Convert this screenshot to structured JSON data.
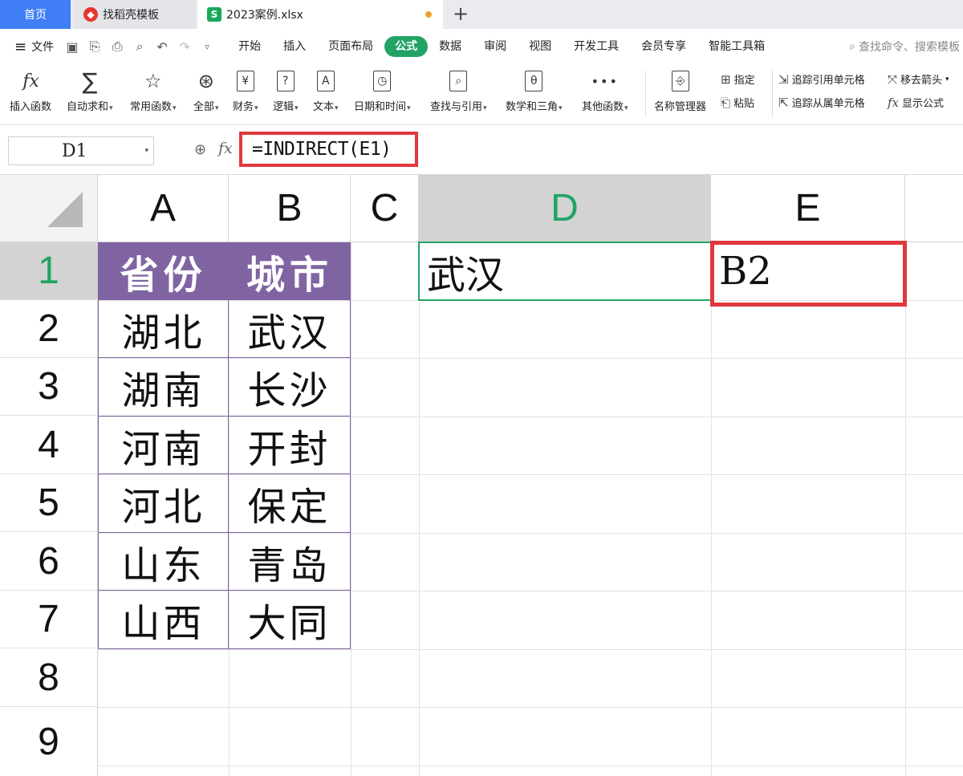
{
  "tabs": {
    "home": "首页",
    "template": "找稻壳模板",
    "file": "2023案例.xlsx"
  },
  "menu": {
    "file_label": "文件",
    "items": [
      "开始",
      "插入",
      "页面布局",
      "公式",
      "数据",
      "审阅",
      "视图",
      "开发工具",
      "会员专享",
      "智能工具箱"
    ],
    "active": "公式",
    "search_placeholder": "查找命令、搜索模板"
  },
  "ribbon": {
    "insert_function": "插入函数",
    "autosum": "自动求和",
    "common": "常用函数",
    "all": "全部",
    "finance": "财务",
    "logic": "逻辑",
    "text": "文本",
    "datetime": "日期和时间",
    "lookup": "查找与引用",
    "math": "数学和三角",
    "other": "其他函数",
    "name_manager": "名称管理器",
    "assign": "指定",
    "paste": "粘贴",
    "trace_precedents": "追踪引用单元格",
    "trace_dependents": "追踪从属单元格",
    "remove_arrows": "移去箭头",
    "show_formulas": "显示公式"
  },
  "formula_bar": {
    "name_box": "D1",
    "formula": "=INDIRECT(E1)"
  },
  "columns": [
    "A",
    "B",
    "C",
    "D",
    "E"
  ],
  "rows": [
    "1",
    "2",
    "3",
    "4",
    "5",
    "6",
    "7",
    "8",
    "9"
  ],
  "table": {
    "headers": [
      "省份",
      "城市"
    ],
    "rows": [
      [
        "湖北",
        "武汉"
      ],
      [
        "湖南",
        "长沙"
      ],
      [
        "河南",
        "开封"
      ],
      [
        "河北",
        "保定"
      ],
      [
        "山东",
        "青岛"
      ],
      [
        "山西",
        "大同"
      ]
    ]
  },
  "cells": {
    "D1": "武汉",
    "E1": "B2"
  },
  "colors": {
    "header_fill": "#8064a2",
    "accent_green": "#21a366",
    "highlight_red": "#e0383e"
  }
}
